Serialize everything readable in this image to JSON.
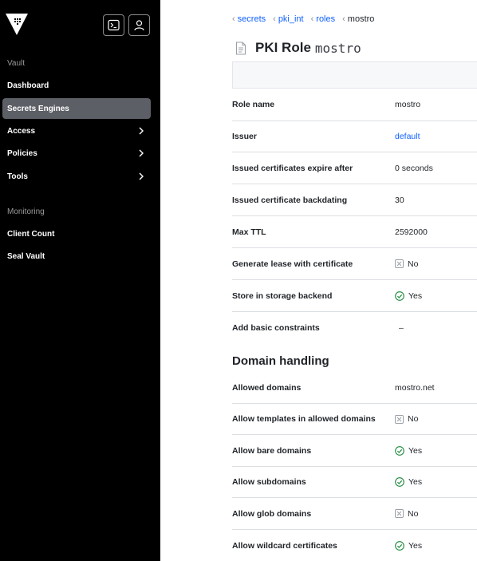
{
  "sidebar": {
    "sections": [
      {
        "label": "Vault",
        "items": [
          {
            "label": "Dashboard",
            "active": false,
            "chevron": false
          },
          {
            "label": "Secrets Engines",
            "active": true,
            "chevron": false
          },
          {
            "label": "Access",
            "active": false,
            "chevron": true
          },
          {
            "label": "Policies",
            "active": false,
            "chevron": true
          },
          {
            "label": "Tools",
            "active": false,
            "chevron": true
          }
        ]
      },
      {
        "label": "Monitoring",
        "items": [
          {
            "label": "Client Count",
            "active": false,
            "chevron": false
          },
          {
            "label": "Seal Vault",
            "active": false,
            "chevron": false
          }
        ]
      }
    ]
  },
  "breadcrumb": [
    "secrets",
    "pki_int",
    "roles",
    "mostro"
  ],
  "header": {
    "title": "PKI Role",
    "role_name": "mostro"
  },
  "details": [
    {
      "label": "Role name",
      "value": "mostro",
      "kind": "text"
    },
    {
      "label": "Issuer",
      "value": "default",
      "kind": "link"
    },
    {
      "label": "Issued certificates expire after",
      "value": "0 seconds",
      "kind": "text"
    },
    {
      "label": "Issued certificate backdating",
      "value": "30",
      "kind": "text"
    },
    {
      "label": "Max TTL",
      "value": "2592000",
      "kind": "text"
    },
    {
      "label": "Generate lease with certificate",
      "value": "No",
      "kind": "no"
    },
    {
      "label": "Store in storage backend",
      "value": "Yes",
      "kind": "yes"
    },
    {
      "label": "Add basic constraints",
      "value": "–",
      "kind": "text"
    }
  ],
  "domain_handling": {
    "heading": "Domain handling",
    "rows": [
      {
        "label": "Allowed domains",
        "value": "mostro.net",
        "kind": "text"
      },
      {
        "label": "Allow templates in allowed domains",
        "value": "No",
        "kind": "no"
      },
      {
        "label": "Allow bare domains",
        "value": "Yes",
        "kind": "yes"
      },
      {
        "label": "Allow subdomains",
        "value": "Yes",
        "kind": "yes"
      },
      {
        "label": "Allow glob domains",
        "value": "No",
        "kind": "no"
      },
      {
        "label": "Allow wildcard certificates",
        "value": "Yes",
        "kind": "yes"
      }
    ]
  },
  "colors": {
    "yes": "#1d8a3c",
    "no": "#9aa0a8",
    "link": "#1060ff",
    "sidebar": "#000000",
    "active_item": "#5d5f66"
  },
  "icons": {
    "logo": "vault-triangle-logo",
    "console": "terminal-icon",
    "user": "user-icon",
    "title": "file-icon",
    "yes": "check-circle-icon",
    "no": "x-square-icon",
    "chevron": "chevron-right-icon",
    "breadcrumb_sep": "chevron-left-icon"
  }
}
